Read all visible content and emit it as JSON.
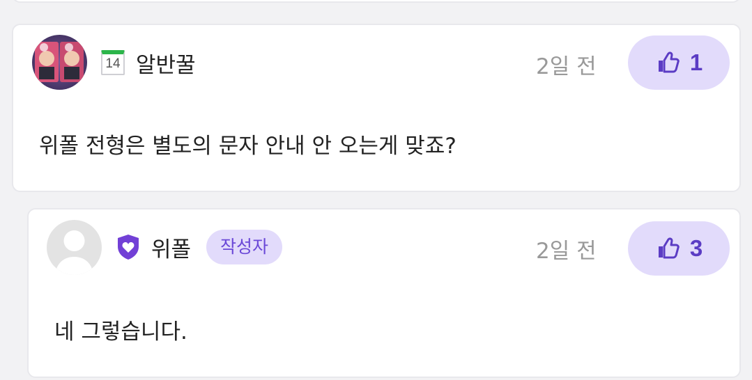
{
  "comments": [
    {
      "username": "알반꿀",
      "level_badge": "14",
      "badge_icon": "calendar-badge-icon",
      "avatar_icon": "user-photo-avatar",
      "time": "2일 전",
      "likes": "1",
      "text": "위폴 전형은 별도의 문자 안내 안 오는게 맞죠?"
    },
    {
      "username": "위폴",
      "badge_icon": "shield-heart-icon",
      "avatar_icon": "default-avatar",
      "author_tag": "작성자",
      "time": "2일 전",
      "likes": "3",
      "text": "네 그렇습니다."
    }
  ],
  "colors": {
    "accent": "#6a48d7",
    "like_bg": "#e2dbfb",
    "level_green": "#2cb54a",
    "muted": "#999999"
  }
}
